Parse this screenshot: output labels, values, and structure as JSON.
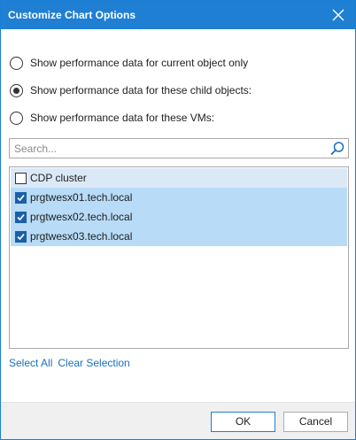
{
  "dialog": {
    "title": "Customize Chart Options",
    "close_icon": "close-icon",
    "accent_color": "#1f7fd3"
  },
  "radio_options": [
    {
      "label": "Show performance data for current object only",
      "selected": false
    },
    {
      "label": "Show performance data for these child objects:",
      "selected": true
    },
    {
      "label": "Show performance data for these VMs:",
      "selected": false
    }
  ],
  "search": {
    "placeholder": "Search...",
    "value": "",
    "icon": "search-icon"
  },
  "list": {
    "items": [
      {
        "label": "CDP cluster",
        "checked": false
      },
      {
        "label": "prgtwesx01.tech.local",
        "checked": true
      },
      {
        "label": "prgtwesx02.tech.local",
        "checked": true
      },
      {
        "label": "prgtwesx03.tech.local",
        "checked": true
      }
    ]
  },
  "links": {
    "select_all": "Select All",
    "clear_selection": "Clear Selection"
  },
  "footer": {
    "ok_label": "OK",
    "cancel_label": "Cancel"
  }
}
